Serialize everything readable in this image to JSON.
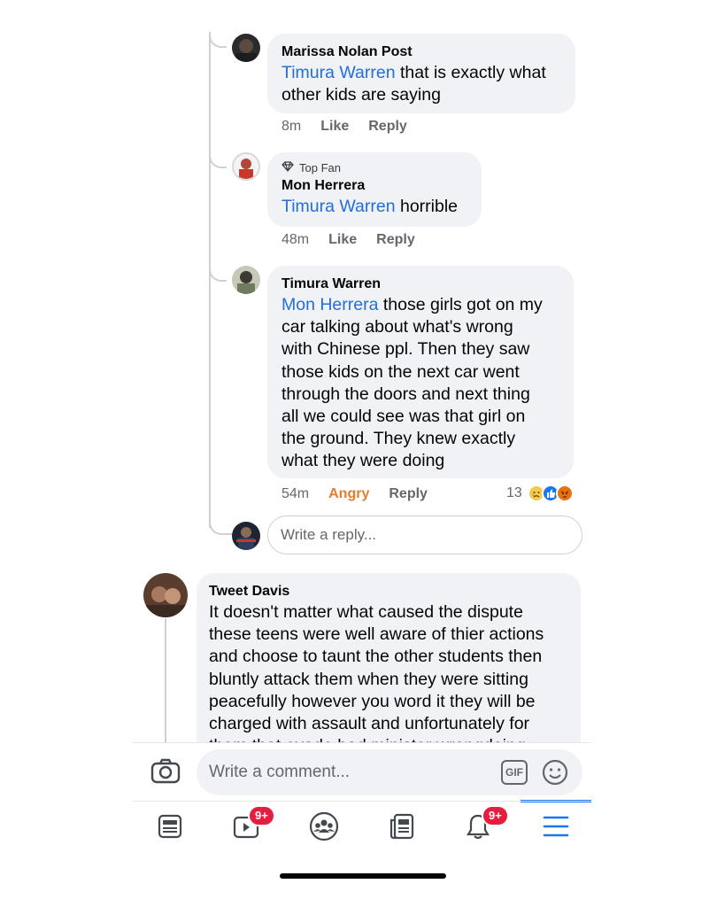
{
  "thread_replies": [
    {
      "author": "Marissa Nolan Post",
      "mention": "Timura Warren",
      "lines": [
        " that is exactly what",
        "other kids are saying"
      ],
      "time": "8m",
      "like_label": "Like",
      "reply_label": "Reply"
    },
    {
      "badge": "Top Fan",
      "author": "Mon Herrera",
      "mention": "Timura Warren",
      "lines": [
        " horrible"
      ],
      "time": "48m",
      "like_label": "Like",
      "reply_label": "Reply"
    },
    {
      "author": "Timura Warren",
      "mention": "Mon Herrera",
      "lines": [
        " those girls got on my",
        "car talking about what's wrong",
        "with Chinese ppl. Then they saw",
        "those kids on the next car went",
        "through the doors and next thing",
        "all we could see was that girl on",
        "the ground. They knew exactly",
        "what they were doing"
      ],
      "time": "54m",
      "reaction_label": "Angry",
      "reply_label": "Reply",
      "reaction_count": "13"
    }
  ],
  "reply_box": {
    "placeholder": "Write a reply..."
  },
  "top_comment": {
    "author": "Tweet Davis",
    "lines": [
      "It doesn't matter what caused the dispute",
      "these teens were well aware of thier actions",
      "and choose to taunt the other students then",
      "bluntly attack them when they were sitting",
      "peacefully however you word it they will be",
      "charged with assault and unfortunately for",
      "them that evade bad minister wrongdoing"
    ]
  },
  "composer": {
    "placeholder": "Write a comment...",
    "gif_label": "GIF"
  },
  "tabbar": {
    "video_badge": "9+",
    "notifications_badge": "9+"
  },
  "colors": {
    "mention": "#216fdb",
    "angry": "#e37e2b",
    "badge": "#e41e3f",
    "active": "#1877f2"
  }
}
